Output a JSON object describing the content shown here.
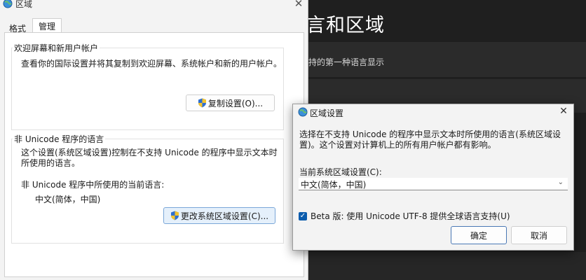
{
  "background_settings": {
    "title": "言和区域",
    "card_text": "持的第一种语言显示"
  },
  "region_dialog": {
    "title": "区域",
    "tabs": [
      {
        "label": "格式"
      },
      {
        "label": "管理"
      }
    ],
    "welcome_group": {
      "legend": "欢迎屏幕和新用户帐户",
      "description": "查看你的国际设置并将其复制到欢迎屏幕、系统帐户和新的用户帐户。",
      "copy_button": "复制设置(O)..."
    },
    "non_unicode_group": {
      "legend": "非 Unicode 程序的语言",
      "description": "这个设置(系统区域设置)控制在不支持 Unicode 的程序中显示文本时所使用的语言。",
      "current_label": "非 Unicode 程序中所使用的当前语言:",
      "current_value": "中文(简体，中国)",
      "change_button": "更改系统区域设置(C)..."
    }
  },
  "regional_settings_dialog": {
    "title": "区域设置",
    "description": "选择在不支持 Unicode 的程序中显示文本时所使用的语言(系统区域设置)。这个设置对计算机上的所有用户帐户都有影响。",
    "select_label": "当前系统区域设置(C):",
    "select_value": "中文(简体，中国)",
    "beta_checkbox_label": "Beta 版: 使用 Unicode UTF-8 提供全球语言支持(U)",
    "beta_checked": true,
    "ok_button": "确定",
    "cancel_button": "取消"
  },
  "colors": {
    "accent": "#0b5cad",
    "dark_bg": "#1f1f1f"
  }
}
